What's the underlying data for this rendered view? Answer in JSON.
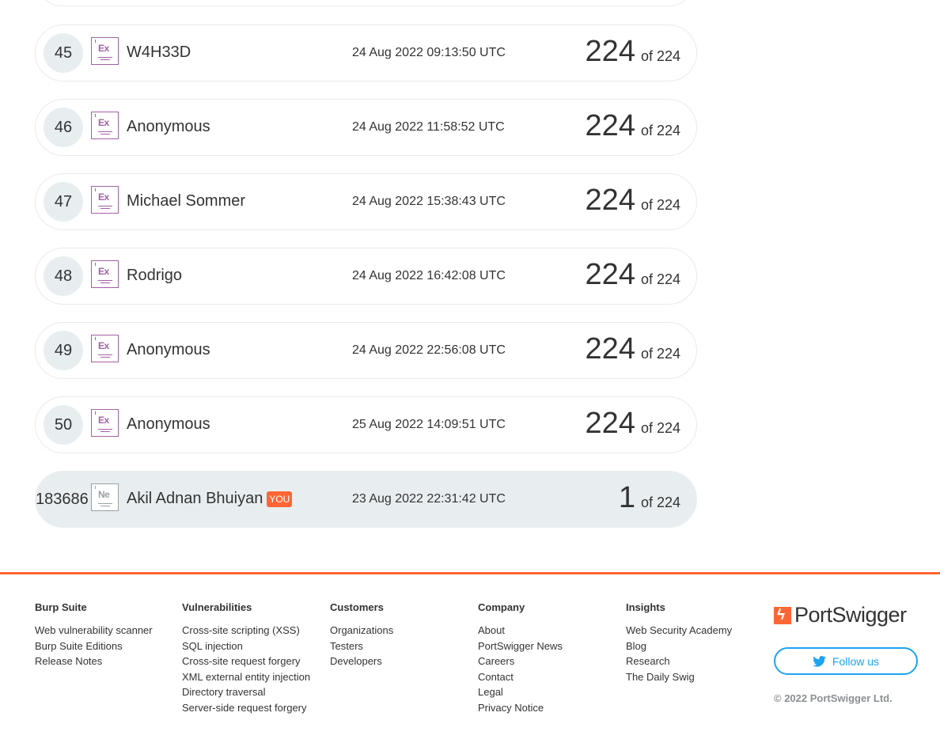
{
  "leaderboard": {
    "rows": [
      {
        "rank": "45",
        "badge": "Ex",
        "name": "W4H33D",
        "date": "24 Aug 2022 09:13:50 UTC",
        "score": "224",
        "of": "of 224"
      },
      {
        "rank": "46",
        "badge": "Ex",
        "name": "Anonymous",
        "date": "24 Aug 2022 11:58:52 UTC",
        "score": "224",
        "of": "of 224"
      },
      {
        "rank": "47",
        "badge": "Ex",
        "name": "Michael Sommer",
        "date": "24 Aug 2022 15:38:43 UTC",
        "score": "224",
        "of": "of 224"
      },
      {
        "rank": "48",
        "badge": "Ex",
        "name": "Rodrigo",
        "date": "24 Aug 2022 16:42:08 UTC",
        "score": "224",
        "of": "of 224"
      },
      {
        "rank": "49",
        "badge": "Ex",
        "name": "Anonymous",
        "date": "24 Aug 2022 22:56:08 UTC",
        "score": "224",
        "of": "of 224"
      },
      {
        "rank": "50",
        "badge": "Ex",
        "name": "Anonymous",
        "date": "25 Aug 2022 14:09:51 UTC",
        "score": "224",
        "of": "of 224"
      }
    ],
    "you_row": {
      "rank": "183686",
      "badge": "Ne",
      "name": "Akil Adnan Bhuiyan",
      "you_label": "YOU",
      "date": "23 Aug 2022 22:31:42 UTC",
      "score": "1",
      "of": "of 224"
    }
  },
  "footer": {
    "columns": [
      {
        "title": "Burp Suite",
        "links": [
          "Web vulnerability scanner",
          "Burp Suite Editions",
          "Release Notes"
        ]
      },
      {
        "title": "Vulnerabilities",
        "links": [
          "Cross-site scripting (XSS)",
          "SQL injection",
          "Cross-site request forgery",
          "XML external entity injection",
          "Directory traversal",
          "Server-side request forgery"
        ]
      },
      {
        "title": "Customers",
        "links": [
          "Organizations",
          "Testers",
          "Developers"
        ]
      },
      {
        "title": "Company",
        "links": [
          "About",
          "PortSwigger News",
          "Careers",
          "Contact",
          "Legal",
          "Privacy Notice"
        ]
      },
      {
        "title": "Insights",
        "links": [
          "Web Security Academy",
          "Blog",
          "Research",
          "The Daily Swig"
        ]
      }
    ],
    "logo_text": "PortSwigger",
    "follow_label": "Follow us",
    "copyright": "© 2022 PortSwigger Ltd."
  },
  "colors": {
    "accent": "#ff6633",
    "badge_expert": "#a560a8",
    "twitter": "#1ca4f0"
  },
  "icons": {
    "logo": "portswigger-logo-icon",
    "follow": "twitter-bird-icon"
  }
}
